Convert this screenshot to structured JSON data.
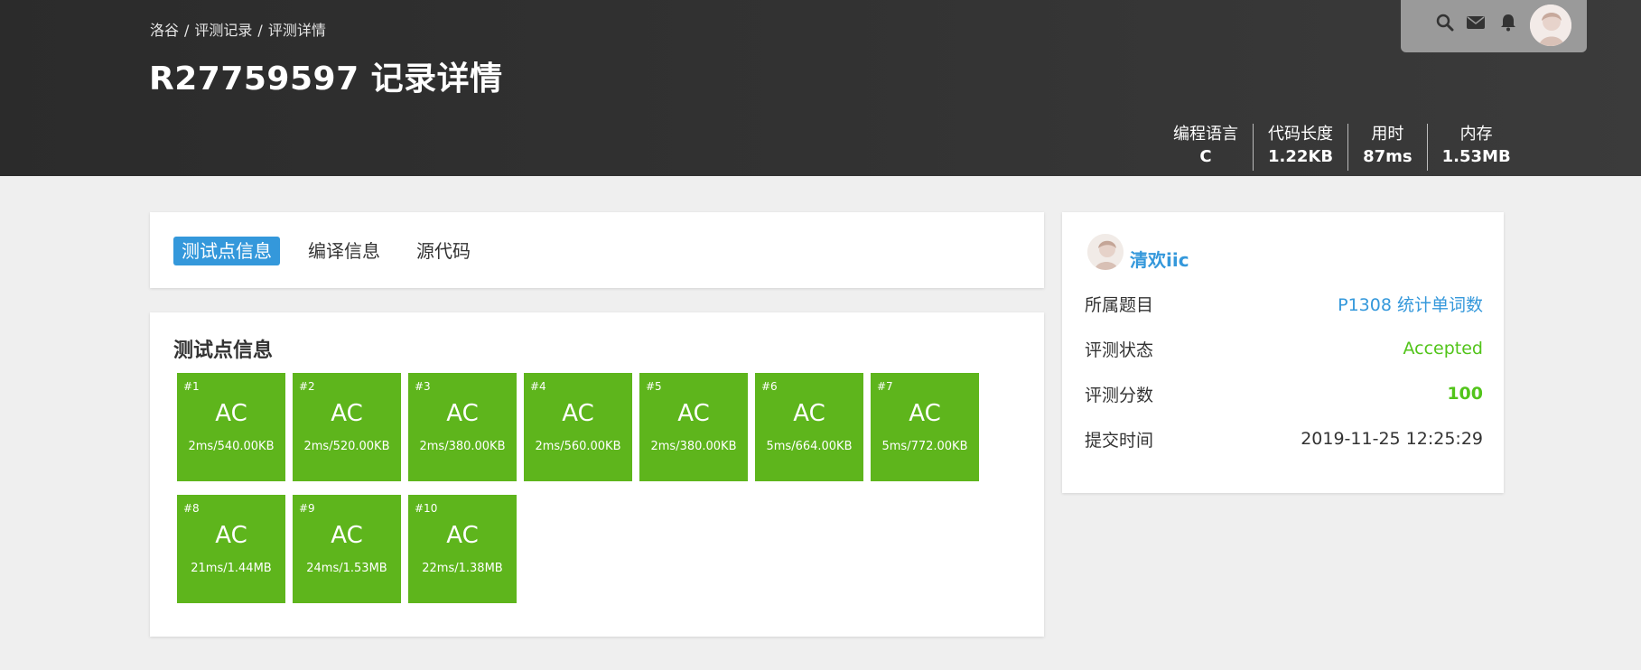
{
  "breadcrumb": [
    "洛谷",
    "评测记录",
    "评测详情"
  ],
  "title": "R27759597 记录详情",
  "top_icons": [
    "search-icon",
    "mail-icon",
    "bell-icon",
    "avatar"
  ],
  "stats": [
    {
      "label": "编程语言",
      "value": "C"
    },
    {
      "label": "代码长度",
      "value": "1.22KB"
    },
    {
      "label": "用时",
      "value": "87ms"
    },
    {
      "label": "内存",
      "value": "1.53MB"
    }
  ],
  "tabs": [
    {
      "label": "测试点信息",
      "active": true
    },
    {
      "label": "编译信息",
      "active": false
    },
    {
      "label": "源代码",
      "active": false
    }
  ],
  "tests": {
    "title": "测试点信息",
    "cases": [
      {
        "num": "#1",
        "status": "AC",
        "detail": "2ms/540.00KB"
      },
      {
        "num": "#2",
        "status": "AC",
        "detail": "2ms/520.00KB"
      },
      {
        "num": "#3",
        "status": "AC",
        "detail": "2ms/380.00KB"
      },
      {
        "num": "#4",
        "status": "AC",
        "detail": "2ms/560.00KB"
      },
      {
        "num": "#5",
        "status": "AC",
        "detail": "2ms/380.00KB"
      },
      {
        "num": "#6",
        "status": "AC",
        "detail": "5ms/664.00KB"
      },
      {
        "num": "#7",
        "status": "AC",
        "detail": "5ms/772.00KB"
      },
      {
        "num": "#8",
        "status": "AC",
        "detail": "21ms/1.44MB"
      },
      {
        "num": "#9",
        "status": "AC",
        "detail": "24ms/1.53MB"
      },
      {
        "num": "#10",
        "status": "AC",
        "detail": "22ms/1.38MB"
      }
    ]
  },
  "info": {
    "user": "清欢iic",
    "rows": [
      {
        "key": "所属题目",
        "value": "P1308 统计单词数"
      },
      {
        "key": "评测状态",
        "value": "Accepted"
      },
      {
        "key": "评测分数",
        "value": "100"
      },
      {
        "key": "提交时间",
        "value": "2019-11-25 12:25:29"
      }
    ]
  },
  "colors": {
    "accent": "#3498db",
    "ac_green": "#5eb51c",
    "status_green": "#52c41a",
    "header_bg": "#2b2b2b"
  }
}
